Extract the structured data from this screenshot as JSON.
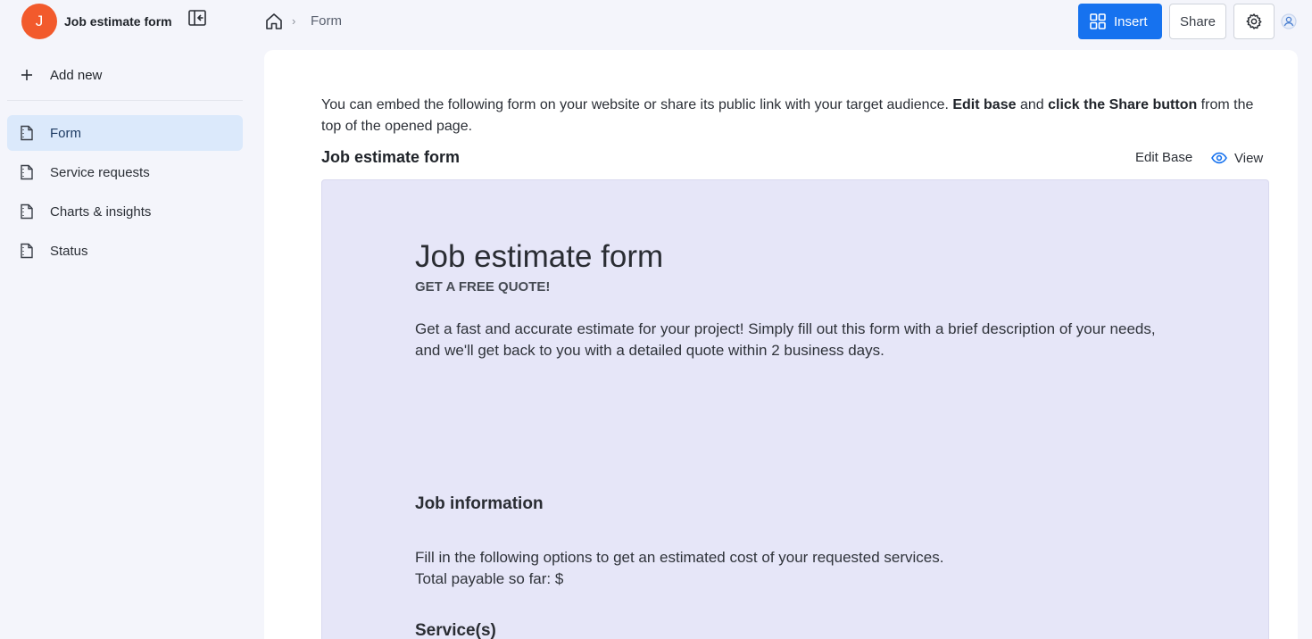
{
  "app": {
    "avatar_letter": "J",
    "title": "Job estimate form",
    "brand_color": "#f25a2c"
  },
  "sidebar": {
    "add_new_label": "Add new",
    "items": [
      {
        "label": "Form",
        "icon": "document-icon",
        "active": true
      },
      {
        "label": "Service requests",
        "icon": "document-icon",
        "active": false
      },
      {
        "label": "Charts & insights",
        "icon": "document-icon",
        "active": false
      },
      {
        "label": "Status",
        "icon": "document-icon",
        "active": false
      }
    ]
  },
  "topbar": {
    "breadcrumb_current": "Form",
    "breadcrumb_separator": "›",
    "insert_label": "Insert",
    "share_label": "Share",
    "accent_color": "#1672ef"
  },
  "main": {
    "intro_text_1": "You can embed the following form on your website or share its public link with your target audience. ",
    "intro_bold_1": "Edit base",
    "intro_text_2": " and ",
    "intro_bold_2": "click the Share button",
    "intro_text_3": " from the top of the opened page.",
    "form_heading": "Job estimate form",
    "edit_base_label": "Edit Base",
    "view_label": "View"
  },
  "preview": {
    "title": "Job estimate form",
    "subtitle": "GET A FREE QUOTE!",
    "description": "Get a fast and accurate estimate for your project! Simply fill out this form with a brief description of your needs, and we'll get back to you with a detailed quote within 2 business days.",
    "section_title": "Job information",
    "section_desc_line1": "Fill in the following options to get an estimated cost of your requested services.",
    "section_desc_line2": "Total payable so far: $",
    "section2_title": "Service(s)",
    "background_color": "#e6e6f8"
  }
}
